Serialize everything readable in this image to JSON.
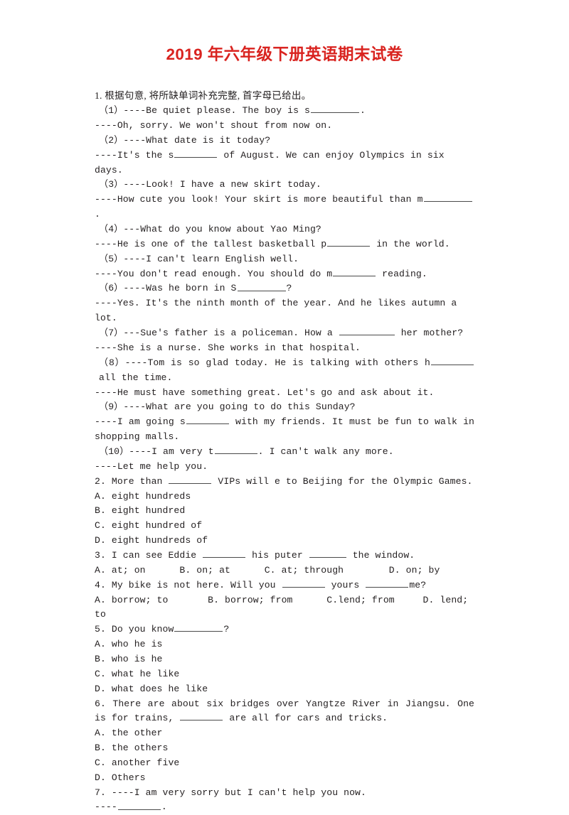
{
  "document": {
    "title": "2019 年六年级下册英语期末试卷",
    "title_color": "#d9231f",
    "background_color": "#ffffff",
    "text_color": "#231f20"
  },
  "section1": {
    "instruction": "1. 根据句意, 将所缺单词补充完整, 首字母已给出。",
    "items": [
      {
        "prompt": "（1）----Be quiet please. The boy is s",
        "blank": "b-lg",
        "prompt_tail": ".",
        "reply": "----Oh, sorry. We won't shout from now on."
      },
      {
        "prompt": "（2）----What date is it today?",
        "blank": "",
        "prompt_tail": "",
        "reply": "----It's the s",
        "reply_blank": "b-md",
        "reply_tail": " of August. We can enjoy Olympics in six days."
      },
      {
        "prompt": "（3）----Look! I have a new skirt today.",
        "reply": "----How cute you look! Your skirt is more beautiful than m",
        "reply_blank": "b-lg",
        "reply_tail": "."
      },
      {
        "prompt": "（4）---What do you know about Yao Ming?",
        "reply": "----He is one of the tallest basketball p",
        "reply_blank": "b-md",
        "reply_tail": " in the world."
      },
      {
        "prompt": "（5）----I can't learn English well.",
        "reply": "----You don't read enough. You should do m",
        "reply_blank": "b-md",
        "reply_tail": " reading."
      },
      {
        "prompt": "（6）----Was he born in S",
        "prompt_blank": "b-lg",
        "prompt_tail": "?",
        "reply": "----Yes. It's the ninth month of the year. And he likes autumn a lot."
      },
      {
        "prompt": "（7）---Sue's father is a policeman. How a ",
        "prompt_blank": "b-xl",
        "prompt_tail": " her mother?",
        "reply": "----She is a nurse. She works in that hospital."
      },
      {
        "prompt": "（8）----Tom is so glad today. He is talking with others h",
        "prompt_blank": "b-md",
        "prompt_tail": " all the time.",
        "reply": "----He must have something great. Let's go and ask about it."
      },
      {
        "prompt": "（9）----What are you going to do this Sunday?",
        "reply": "----I am going s",
        "reply_blank": "b-md",
        "reply_tail": " with my friends. It must be fun to walk in shopping malls."
      },
      {
        "prompt": "（10）----I am very t",
        "prompt_blank": "b-md",
        "prompt_tail": ". I can't walk any more.",
        "reply": "----Let me help you."
      }
    ],
    "line_1_1": "（1）----Be quiet please. The boy is s",
    "line_1_1_tail": ".",
    "line_1_1r": "----Oh, sorry. We won't shout from now on.",
    "line_1_2": "（2）----What date is it today?",
    "line_1_2r_head": "----It's the s",
    "line_1_2r_tail": " of August. We can enjoy Olympics in six days.",
    "line_1_3": "（3）----Look! I have a new skirt today.",
    "line_1_3r_head": "----How cute you look! Your skirt is more beautiful than m",
    "line_1_3r_tail": ".",
    "line_1_4": "（4）---What do you know about Yao Ming?",
    "line_1_4r_head": "----He is one of the tallest basketball p",
    "line_1_4r_tail": " in the world.",
    "line_1_5": "（5）----I can't learn English well.",
    "line_1_5r_head": "----You don't read enough. You should do m",
    "line_1_5r_tail": " reading.",
    "line_1_6_head": "（6）----Was he born in S",
    "line_1_6_tail": "?",
    "line_1_6r": "----Yes. It's the ninth month of the year. And he likes autumn a lot.",
    "line_1_7_head": "（7）---Sue's father is a policeman. How a ",
    "line_1_7_tail": " her mother?",
    "line_1_7r": "----She is a nurse. She works in that hospital.",
    "line_1_8_head": "（8）----Tom is so glad today. He is talking with others h",
    "line_1_8_tail": " all the time.",
    "line_1_8r": "----He must have something great. Let's go and ask about it.",
    "line_1_9": "（9）----What are you going to do this Sunday?",
    "line_1_9r_head": "----I am going s",
    "line_1_9r_tail": " with my friends. It must be fun to walk in shopping malls.",
    "line_1_10_head": "（10）----I am very t",
    "line_1_10_tail": ". I can't walk any more.",
    "line_1_10r": "----Let me help you."
  },
  "question2": {
    "stem_head": "2. More than ",
    "stem_tail": " VIPs will e to Beijing for the Olympic Games.",
    "choices": [
      "A. eight hundreds",
      "B. eight hundred",
      "C. eight hundred of",
      "D. eight hundreds of"
    ]
  },
  "question3": {
    "stem_head": "3. I can see Eddie ",
    "stem_mid": " his puter ",
    "stem_tail": " the window.",
    "choices_line": "A. at; on      B. on; at      C. at; through        D. on; by"
  },
  "question4": {
    "stem_head": "4. My bike is not here. Will you ",
    "stem_mid": " yours ",
    "stem_tail": "me?",
    "choices_line": "A. borrow; to       B. borrow; from      C.lend; from     D. lend; to"
  },
  "question5": {
    "stem_head": "5. Do you know",
    "stem_tail": "?",
    "choices": [
      "A. who he is",
      "B. who is he",
      "C. what he like",
      "D. what does he like"
    ]
  },
  "question6": {
    "stem_head": "6. There are about six bridges over Yangtze River in Jiangsu. One is for trains, ",
    "stem_tail": " are all for cars and tricks.",
    "choices": [
      "A. the other",
      "B. the others",
      "C. another five",
      "D. Others"
    ]
  },
  "question7": {
    "stem": "7. ----I am very sorry but I can't help you now.",
    "reply_head": "----",
    "reply_tail": "."
  }
}
